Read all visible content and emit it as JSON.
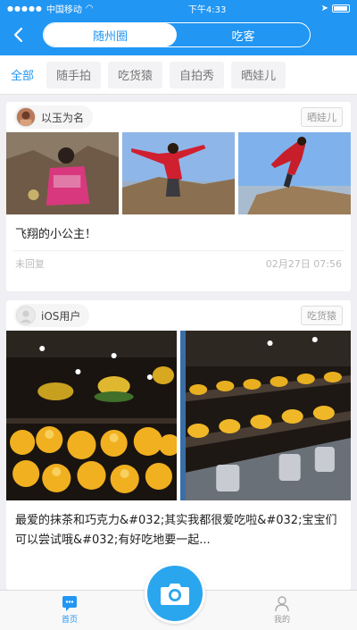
{
  "status_bar": {
    "carrier": "中国移动",
    "time": "下午4:33"
  },
  "nav": {
    "back_icon": "chevron-left-icon",
    "segments": [
      {
        "label": "随州圈",
        "active": true
      },
      {
        "label": "吃客",
        "active": false
      }
    ]
  },
  "tabs": [
    {
      "label": "全部",
      "active": true
    },
    {
      "label": "随手拍",
      "active": false
    },
    {
      "label": "吃货猿",
      "active": false
    },
    {
      "label": "自拍秀",
      "active": false
    },
    {
      "label": "晒娃儿",
      "active": false
    }
  ],
  "posts": [
    {
      "username": "以玉为名",
      "category": "晒娃儿",
      "text": "飞翔的小公主！",
      "reply_status": "未回复",
      "timestamp": "02月27日 07:56"
    },
    {
      "username": "iOS用户",
      "category": "吃货猿",
      "text": "最爱的抹茶和巧克力&#032;其实我都很爱吃啦&#032;宝宝们可以尝试哦&#032;有好吃地要一起..."
    }
  ],
  "tabbar": {
    "home_label": "首页",
    "mine_label": "我的",
    "camera_icon": "camera-icon"
  },
  "colors": {
    "accent": "#2196f3"
  }
}
